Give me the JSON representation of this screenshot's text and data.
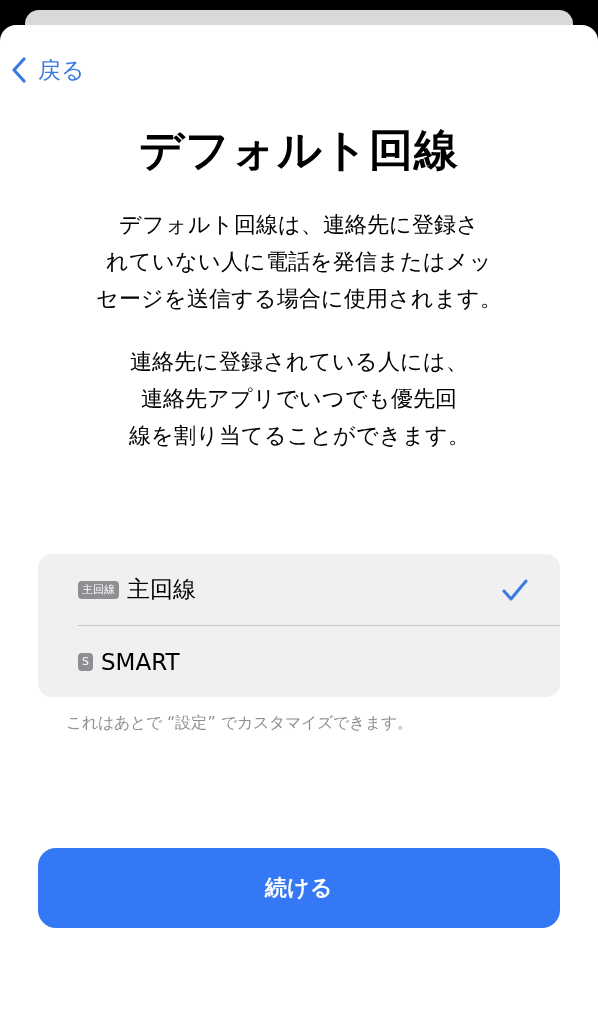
{
  "nav": {
    "back": "戻る"
  },
  "title": "デフォルト回線",
  "paragraphs": [
    [
      "デフォルト回線は、連絡先に登録さ",
      "れていない人に電話を発信またはメッ",
      "セージを送信する場合に使用されます。"
    ],
    [
      "連絡先に登録されている人には、",
      "連絡先アプリでいつでも優先回",
      "線を割り当てることができます。"
    ]
  ],
  "lines": [
    {
      "badge": "主回線",
      "label": "主回線",
      "selected": true
    },
    {
      "badge": "S",
      "label": "SMART",
      "selected": false
    }
  ],
  "footnote": "これはあとで “設定” でカスタマイズできます。",
  "continue_button": "続ける"
}
